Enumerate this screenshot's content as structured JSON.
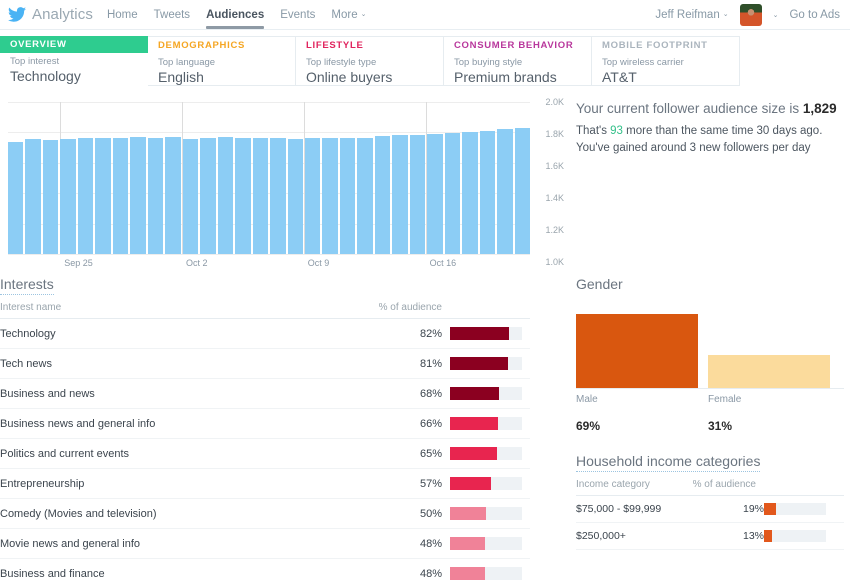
{
  "nav": {
    "brand": "Analytics",
    "logo_icon": "twitter-bird-icon",
    "links": [
      {
        "label": "Home",
        "active": false
      },
      {
        "label": "Tweets",
        "active": false
      },
      {
        "label": "Audiences",
        "active": true
      },
      {
        "label": "Events",
        "active": false
      },
      {
        "label": "More",
        "active": false,
        "caret": "⌄"
      }
    ],
    "user_name": "Jeff Reifman",
    "user_caret": "⌄",
    "avatar_caret": "⌄",
    "go_to_ads": "Go to Ads"
  },
  "cards": [
    {
      "tag": "OVERVIEW",
      "sub": "Top interest",
      "value": "Technology",
      "color": "#2ecc8f",
      "active": true
    },
    {
      "tag": "DEMOGRAPHICS",
      "sub": "Top language",
      "value": "English",
      "color": "#f5a623",
      "active": false
    },
    {
      "tag": "LIFESTYLE",
      "sub": "Top lifestyle type",
      "value": "Online buyers",
      "color": "#e0245e",
      "active": false
    },
    {
      "tag": "CONSUMER BEHAVIOR",
      "sub": "Top buying style",
      "value": "Premium brands",
      "color": "#b8379c",
      "active": false
    },
    {
      "tag": "MOBILE FOOTPRINT",
      "sub": "Top wireless carrier",
      "value": "AT&T",
      "color": "#aab4bd",
      "active": false
    }
  ],
  "summary": {
    "headline_prefix": "Your current follower audience size is ",
    "headline_value": "1,829",
    "body_prefix": "That's ",
    "body_delta": "93",
    "body_suffix": " more than the same time 30 days ago. You've gained around 3 new followers per day"
  },
  "chart_data": {
    "type": "bar",
    "title": "Follower audience size",
    "xlabel": "",
    "ylabel": "",
    "ylim": [
      1000,
      2000
    ],
    "grid": true,
    "legend": false,
    "bar_color": "#8ccdf5",
    "ytick_labels": [
      "2.0K",
      "1.8K",
      "1.6K",
      "1.4K",
      "1.2K",
      "1.0K"
    ],
    "ytick_values": [
      2000,
      1800,
      1600,
      1400,
      1200,
      1000
    ],
    "xtick_labels": [
      "Sep 25",
      "Oct 2",
      "Oct 9",
      "Oct 16"
    ],
    "xtick_indices": [
      3,
      10,
      17,
      24
    ],
    "categories": [
      "Sep 22",
      "Sep 23",
      "Sep 24",
      "Sep 25",
      "Sep 26",
      "Sep 27",
      "Sep 28",
      "Sep 29",
      "Sep 30",
      "Oct 1",
      "Oct 2",
      "Oct 3",
      "Oct 4",
      "Oct 5",
      "Oct 6",
      "Oct 7",
      "Oct 8",
      "Oct 9",
      "Oct 10",
      "Oct 11",
      "Oct 12",
      "Oct 13",
      "Oct 14",
      "Oct 15",
      "Oct 16",
      "Oct 17",
      "Oct 18",
      "Oct 19",
      "Oct 20",
      "Oct 21"
    ],
    "values": [
      1736,
      1754,
      1750,
      1756,
      1760,
      1764,
      1760,
      1772,
      1762,
      1770,
      1756,
      1762,
      1768,
      1766,
      1762,
      1764,
      1758,
      1762,
      1760,
      1762,
      1766,
      1774,
      1780,
      1786,
      1790,
      1794,
      1800,
      1808,
      1822,
      1829
    ]
  },
  "interests": {
    "title": "Interests",
    "columns": [
      "Interest name",
      "% of audience"
    ],
    "rows": [
      {
        "name": "Technology",
        "pct": "82%",
        "value": 82,
        "color": "#8b0020"
      },
      {
        "name": "Tech news",
        "pct": "81%",
        "value": 81,
        "color": "#8b0020"
      },
      {
        "name": "Business and news",
        "pct": "68%",
        "value": 68,
        "color": "#8b0020"
      },
      {
        "name": "Business news and general info",
        "pct": "66%",
        "value": 66,
        "color": "#e8254f"
      },
      {
        "name": "Politics and current events",
        "pct": "65%",
        "value": 65,
        "color": "#e8254f"
      },
      {
        "name": "Entrepreneurship",
        "pct": "57%",
        "value": 57,
        "color": "#e8254f"
      },
      {
        "name": "Comedy (Movies and television)",
        "pct": "50%",
        "value": 50,
        "color": "#f08298"
      },
      {
        "name": "Movie news and general info",
        "pct": "48%",
        "value": 48,
        "color": "#f08298"
      },
      {
        "name": "Business and finance",
        "pct": "48%",
        "value": 48,
        "color": "#f08298"
      }
    ]
  },
  "gender": {
    "title": "Gender",
    "bars": [
      {
        "label": "Male",
        "pct": "69%",
        "value": 69,
        "color": "#d9570f"
      },
      {
        "label": "Female",
        "pct": "31%",
        "value": 31,
        "color": "#fbdb9c"
      }
    ]
  },
  "income": {
    "title": "Household income categories",
    "columns": [
      "Income category",
      "% of audience"
    ],
    "rows": [
      {
        "name": "$75,000 - $99,999",
        "pct": "19%",
        "value": 19,
        "color": "#e2581c"
      },
      {
        "name": "$250,000+",
        "pct": "13%",
        "value": 13,
        "color": "#e2581c"
      }
    ]
  }
}
